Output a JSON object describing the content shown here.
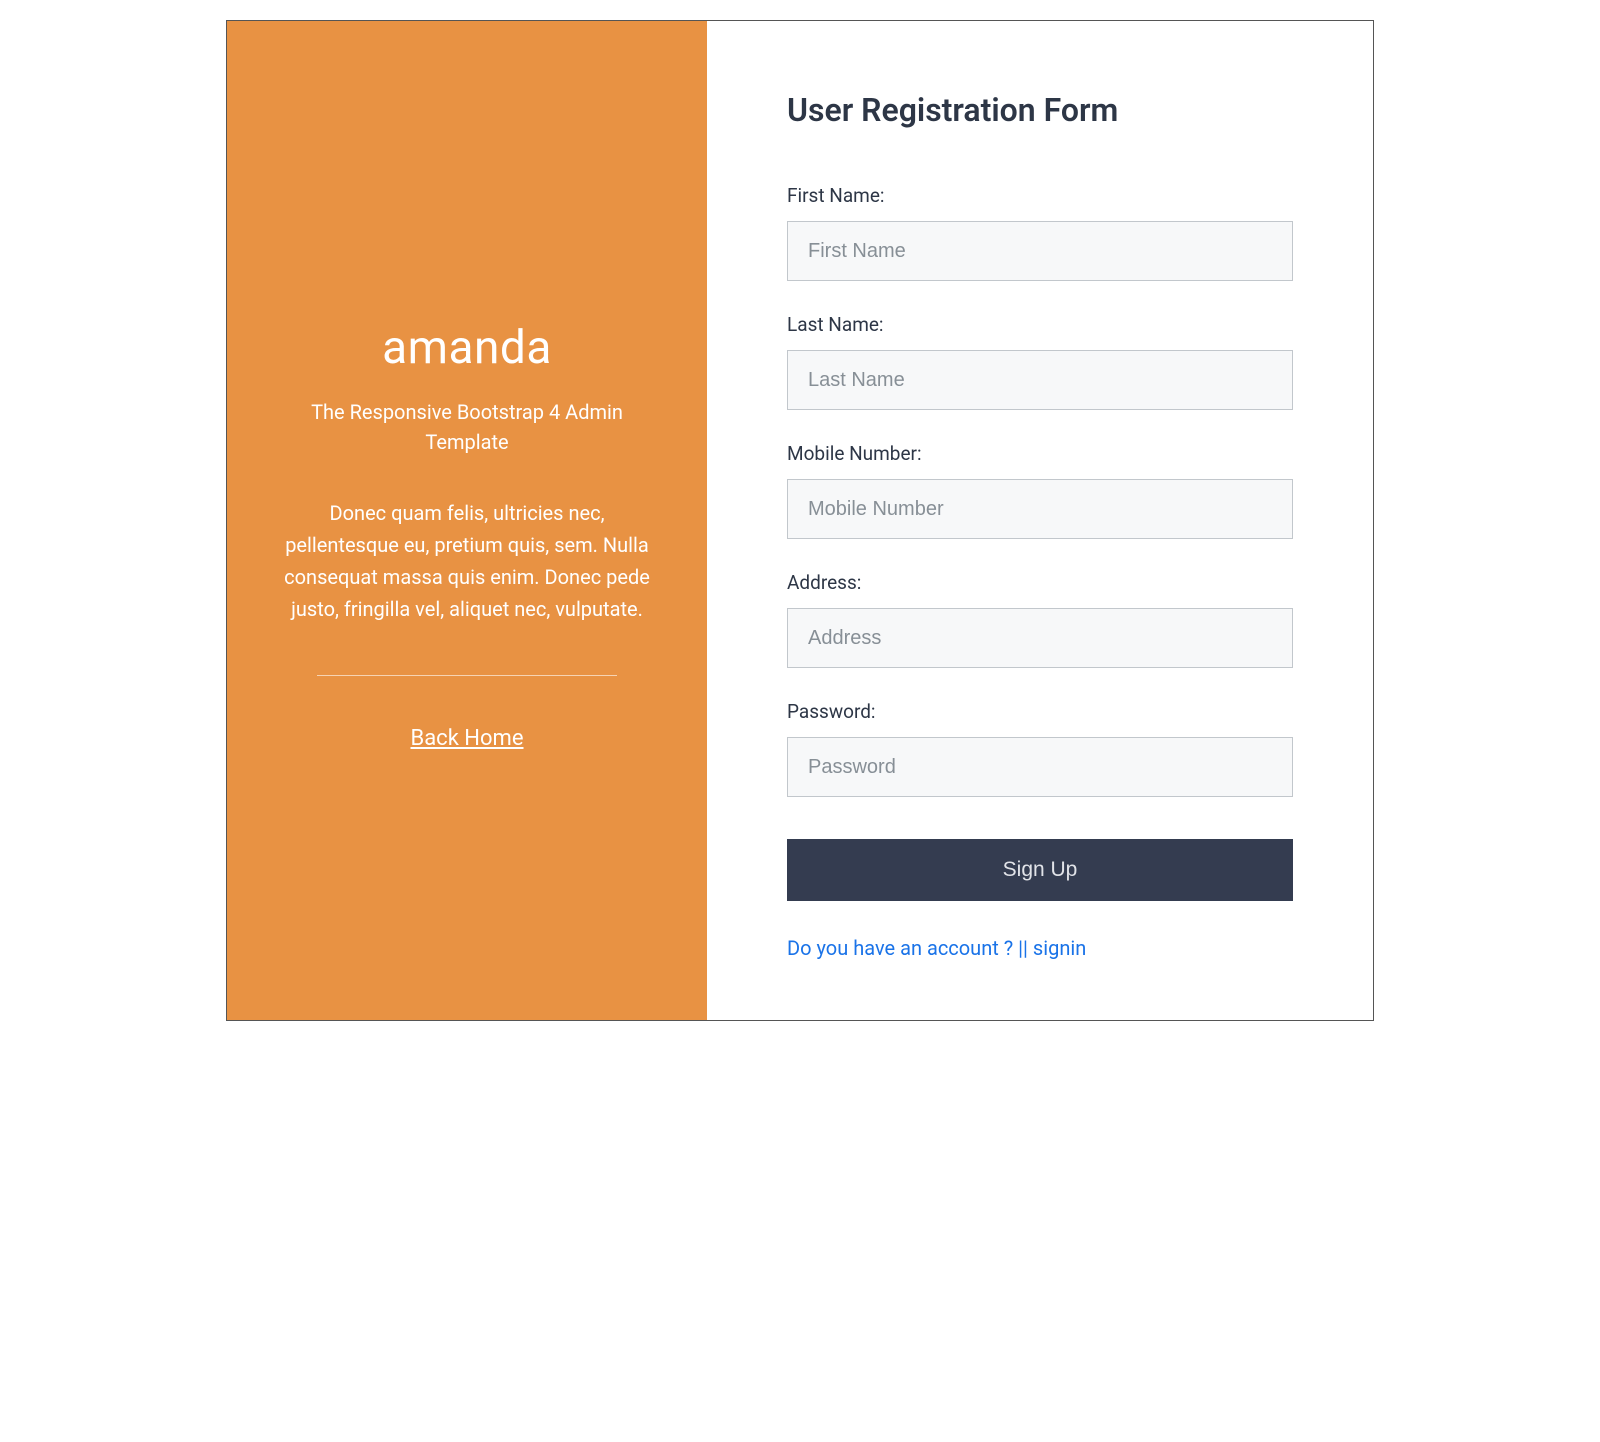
{
  "left": {
    "brand": "amanda",
    "subtitle": "The Responsive Bootstrap 4 Admin Template",
    "description": "Donec quam felis, ultricies nec, pellentesque eu, pretium quis, sem. Nulla consequat massa quis enim. Donec pede justo, fringilla vel, aliquet nec, vulputate.",
    "back_link": "Back Home"
  },
  "form": {
    "title": "User Registration Form",
    "fields": {
      "first_name": {
        "label": "First Name:",
        "placeholder": "First Name"
      },
      "last_name": {
        "label": "Last Name:",
        "placeholder": "Last Name"
      },
      "mobile": {
        "label": "Mobile Number:",
        "placeholder": "Mobile Number"
      },
      "address": {
        "label": "Address:",
        "placeholder": "Address"
      },
      "password": {
        "label": "Password:",
        "placeholder": "Password"
      }
    },
    "submit_label": "Sign Up",
    "signin_text": "Do you have an account ? || signin"
  }
}
